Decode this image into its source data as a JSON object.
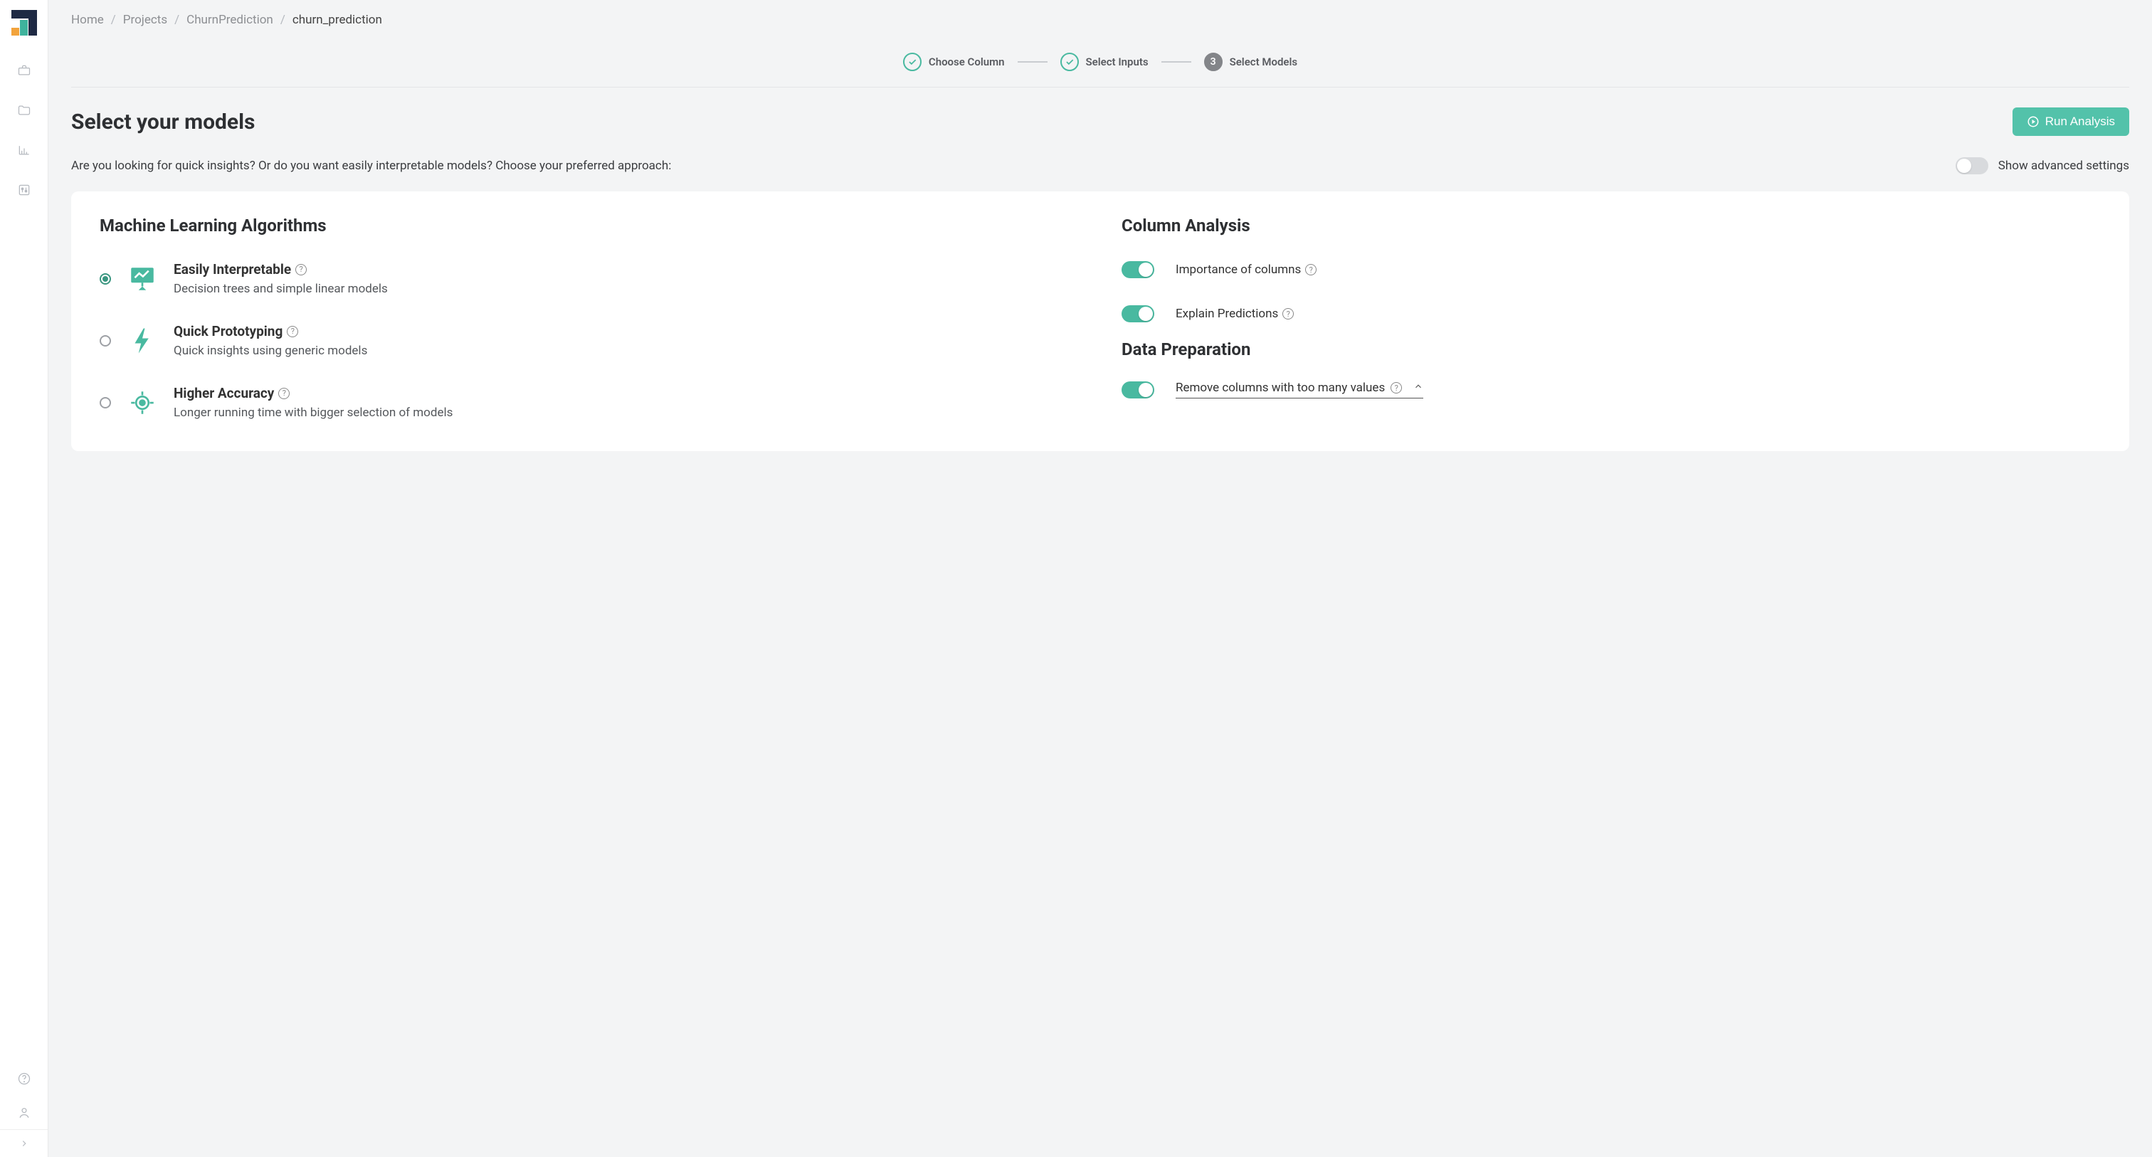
{
  "breadcrumb": {
    "items": [
      "Home",
      "Projects",
      "ChurnPrediction"
    ],
    "current": "churn_prediction"
  },
  "stepper": {
    "steps": [
      {
        "label": "Choose Column",
        "state": "done"
      },
      {
        "label": "Select Inputs",
        "state": "done"
      },
      {
        "label": "Select Models",
        "state": "active",
        "number": "3"
      }
    ]
  },
  "page": {
    "title": "Select your models",
    "run_button": "Run Analysis",
    "subtitle": "Are you looking for quick insights? Or do you want easily interpretable models? Choose your preferred approach:",
    "advanced_label": "Show advanced settings",
    "advanced_on": false
  },
  "algorithms": {
    "heading": "Machine Learning Algorithms",
    "items": [
      {
        "title": "Easily Interpretable",
        "desc": "Decision trees and simple linear models",
        "selected": true
      },
      {
        "title": "Quick Prototyping",
        "desc": "Quick insights using generic models",
        "selected": false
      },
      {
        "title": "Higher Accuracy",
        "desc": "Longer running time with bigger selection of models",
        "selected": false
      }
    ]
  },
  "column_analysis": {
    "heading": "Column Analysis",
    "options": [
      {
        "label": "Importance of columns",
        "on": true
      },
      {
        "label": "Explain Predictions",
        "on": true
      }
    ]
  },
  "data_prep": {
    "heading": "Data Preparation",
    "option": {
      "label": "Remove columns with too many values",
      "on": true
    }
  }
}
